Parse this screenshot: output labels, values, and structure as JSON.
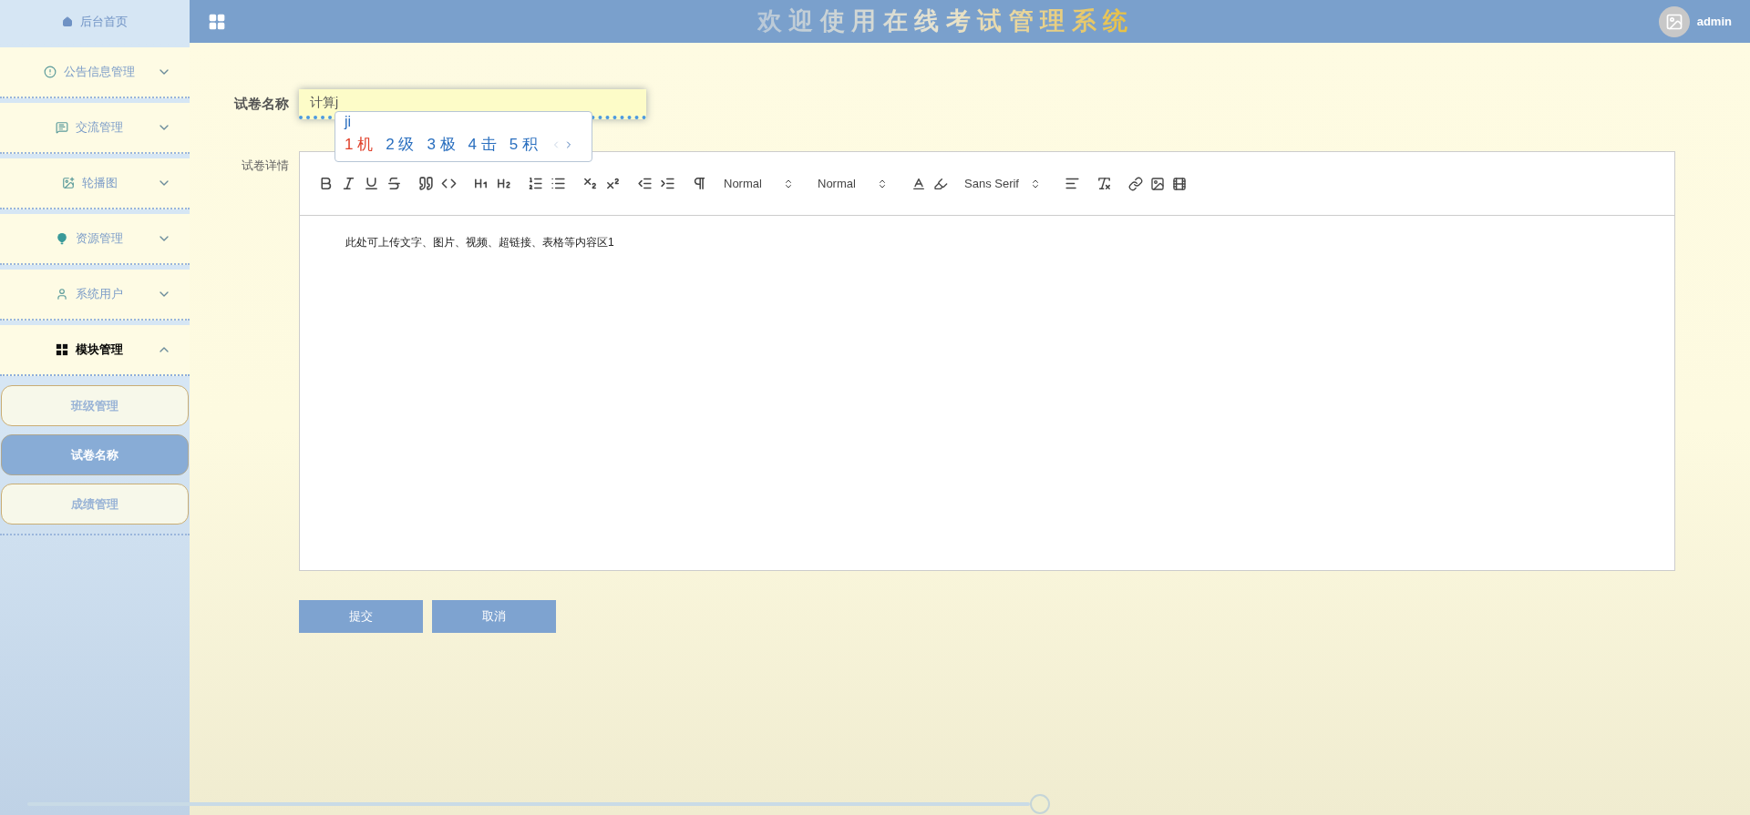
{
  "sidebar": {
    "home": "后台首页",
    "menus": [
      {
        "label": "公告信息管理",
        "expanded": false
      },
      {
        "label": "交流管理",
        "expanded": false
      },
      {
        "label": "轮播图",
        "expanded": false
      },
      {
        "label": "资源管理",
        "expanded": false
      },
      {
        "label": "系统用户",
        "expanded": false
      },
      {
        "label": "模块管理",
        "expanded": true,
        "children": [
          {
            "label": "班级管理",
            "selected": false
          },
          {
            "label": "试卷名称",
            "selected": true
          },
          {
            "label": "成绩管理",
            "selected": false
          }
        ]
      }
    ]
  },
  "header": {
    "title": "欢 迎 使 用 在 线 考 试 管 理 系 统",
    "user": "admin"
  },
  "form": {
    "name_label": "试卷名称",
    "name_value": "计算j",
    "detail_label": "试卷详情",
    "ime": {
      "composition": "ji",
      "candidates": [
        {
          "index": "1",
          "char": "机",
          "selected": true
        },
        {
          "index": "2",
          "char": "级",
          "selected": false
        },
        {
          "index": "3",
          "char": "极",
          "selected": false
        },
        {
          "index": "4",
          "char": "击",
          "selected": false
        },
        {
          "index": "5",
          "char": "积",
          "selected": false
        }
      ]
    },
    "toolbar": {
      "header_picker": "Normal",
      "size_picker": "Normal",
      "font_picker": "Sans Serif"
    },
    "editor_text": "此处可上传文字、图片、视频、超链接、表格等内容区1",
    "buttons": [
      "提交",
      "取消"
    ]
  }
}
